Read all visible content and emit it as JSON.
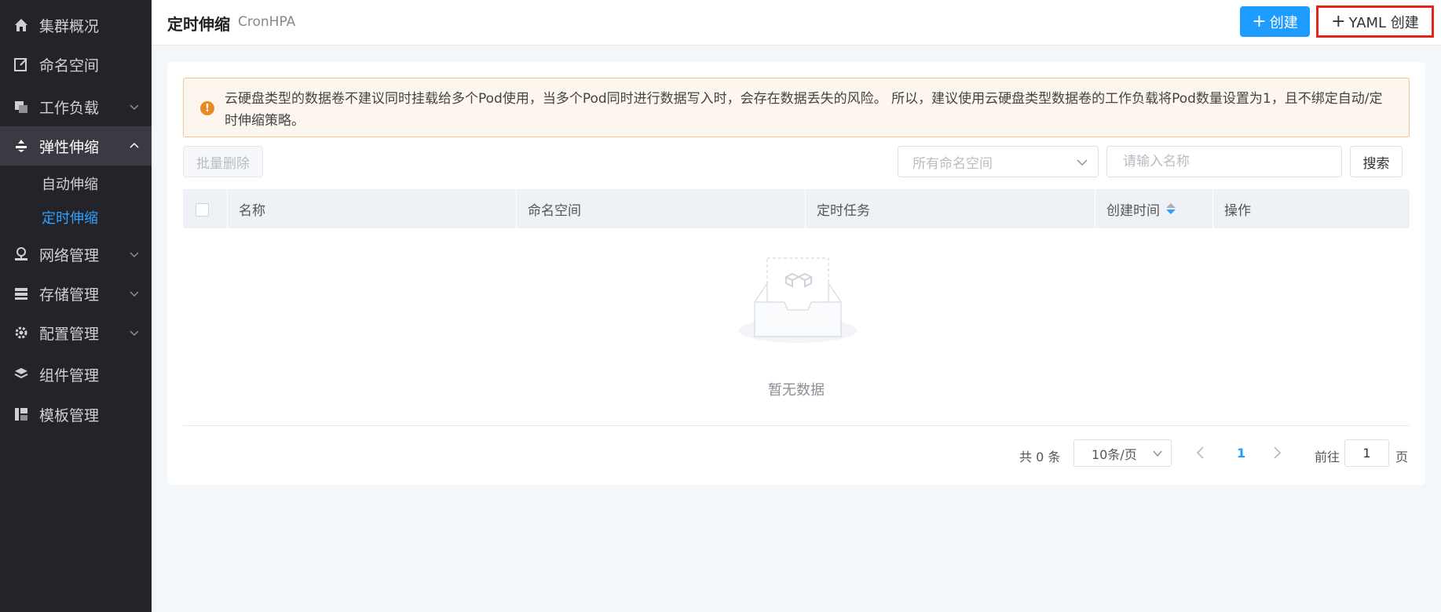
{
  "sidebar": {
    "items": [
      {
        "label": "集群概况",
        "icon": "home-icon"
      },
      {
        "label": "命名空间",
        "icon": "edit-icon"
      },
      {
        "label": "工作负载",
        "icon": "copy-icon"
      },
      {
        "label": "弹性伸缩",
        "icon": "scale-icon"
      },
      {
        "label": "网络管理",
        "icon": "network-icon"
      },
      {
        "label": "存储管理",
        "icon": "storage-icon"
      },
      {
        "label": "配置管理",
        "icon": "gear-icon"
      },
      {
        "label": "组件管理",
        "icon": "layers-icon"
      },
      {
        "label": "模板管理",
        "icon": "template-icon"
      }
    ],
    "sub_items": [
      {
        "label": "自动伸缩"
      },
      {
        "label": "定时伸缩"
      }
    ]
  },
  "header": {
    "title": "定时伸缩",
    "subtitle": "CronHPA",
    "create_label": "创建",
    "yaml_create_label": "YAML 创建"
  },
  "alert": {
    "text": "云硬盘类型的数据卷不建议同时挂载给多个Pod使用，当多个Pod同时进行数据写入时，会存在数据丢失的风险。 所以，建议使用云硬盘类型数据卷的工作负载将Pod数量设置为1，且不绑定自动/定时伸缩策略。"
  },
  "toolbar": {
    "batch_delete_label": "批量删除",
    "namespace_placeholder": "所有命名空间",
    "name_placeholder": "请输入名称",
    "search_label": "搜索"
  },
  "table": {
    "columns": [
      "名称",
      "命名空间",
      "定时任务",
      "创建时间",
      "操作"
    ],
    "empty_text": "暂无数据"
  },
  "pagination": {
    "total_text": "共 0 条",
    "page_size": "10条/页",
    "current_page": "1",
    "goto_label": "前往",
    "goto_value": "1",
    "page_suffix": "页"
  },
  "colors": {
    "sidebar_bg": "#232329",
    "accent": "#1e9cff",
    "highlight_border": "#e5241c",
    "alert_bg": "#fdf6ee",
    "alert_icon": "#e98a22"
  }
}
